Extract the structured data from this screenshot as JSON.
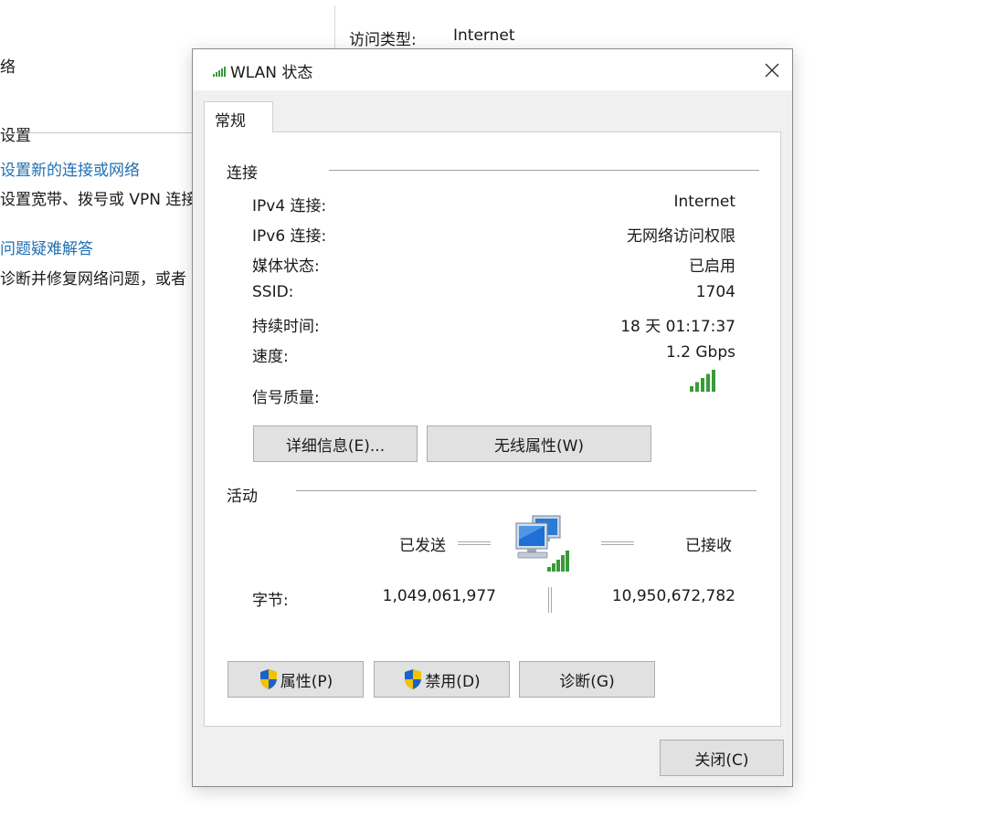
{
  "background": {
    "access_type_label": "访问类型:",
    "access_type_value": "Internet",
    "network_name_fragment": "络",
    "settings_heading_fragment": "设置",
    "setup_link": "设置新的连接或网络",
    "setup_desc": "设置宽带、拨号或 VPN 连接",
    "troubleshoot_link": "问题疑难解答",
    "troubleshoot_desc": "诊断并修复网络问题，或者"
  },
  "dialog": {
    "title": "WLAN 状态",
    "tab_general": "常规",
    "connection": {
      "heading": "连接",
      "rows": [
        {
          "label": "IPv4 连接:",
          "value": "Internet"
        },
        {
          "label": "IPv6 连接:",
          "value": "无网络访问权限"
        },
        {
          "label": "媒体状态:",
          "value": "已启用"
        },
        {
          "label": "SSID:",
          "value": "1704"
        },
        {
          "label": "持续时间:",
          "value": "18 天 01:17:37"
        },
        {
          "label": "速度:",
          "value": "1.2 Gbps"
        }
      ],
      "signal_label": "信号质量:",
      "signal_bars": 5,
      "details_button": "详细信息(E)...",
      "wireless_props_button": "无线属性(W)"
    },
    "activity": {
      "heading": "活动",
      "sent_label": "已发送",
      "received_label": "已接收",
      "bytes_label": "字节:",
      "bytes_sent": "1,049,061,977",
      "bytes_received": "10,950,672,782"
    },
    "buttons": {
      "properties": "属性(P)",
      "disable": "禁用(D)",
      "diagnose": "诊断(G)",
      "close": "关闭(C)"
    },
    "colors": {
      "signal_green": "#3a9a3a",
      "link_blue": "#1f6fb2",
      "shield_blue": "#1a63c6",
      "shield_yellow": "#f2c200"
    }
  }
}
